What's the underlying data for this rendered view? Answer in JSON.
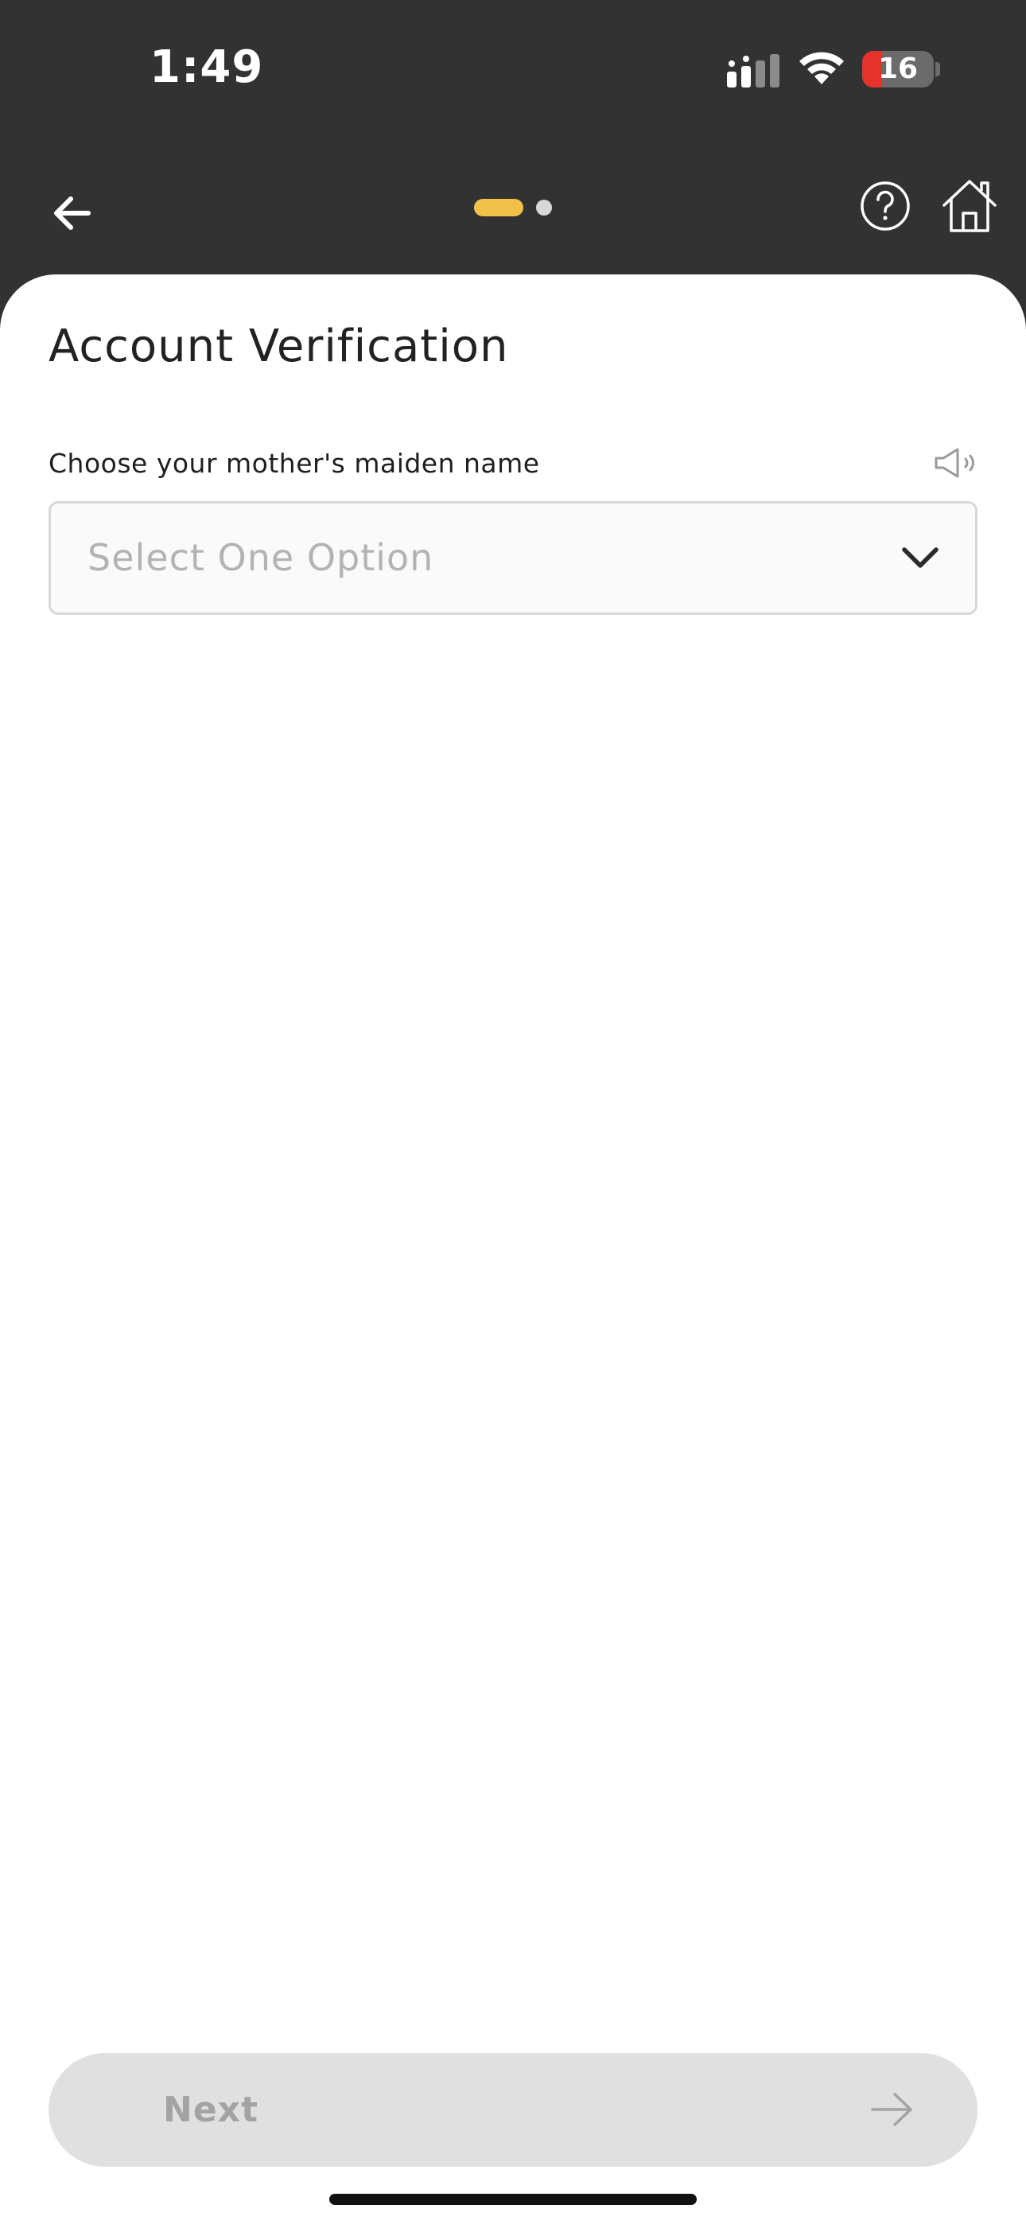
{
  "status_bar": {
    "time": "1:49",
    "battery_level": "16",
    "battery_fraction": 0.16
  },
  "header": {
    "back_icon": "arrow-left-icon",
    "help_icon": "question-circle-icon",
    "home_icon": "home-icon",
    "progress": {
      "total_steps": 2,
      "current_step": 1,
      "active_color": "#f2c14a",
      "inactive_color": "#d8d8d8"
    }
  },
  "page": {
    "title": "Account Verification",
    "question": {
      "label": "Choose your mother's maiden name",
      "audio_icon": "speaker-icon",
      "select": {
        "placeholder": "Select One Option",
        "selected_value": ""
      }
    }
  },
  "footer": {
    "next_label": "Next",
    "next_icon": "arrow-right-icon",
    "enabled": false
  },
  "colors": {
    "header_bg": "#323232",
    "card_bg": "#ffffff",
    "accent": "#f2c14a",
    "battery_low": "#e5322d",
    "disabled_button_bg": "#e0e0e0",
    "disabled_button_text": "#a3a3a3"
  }
}
